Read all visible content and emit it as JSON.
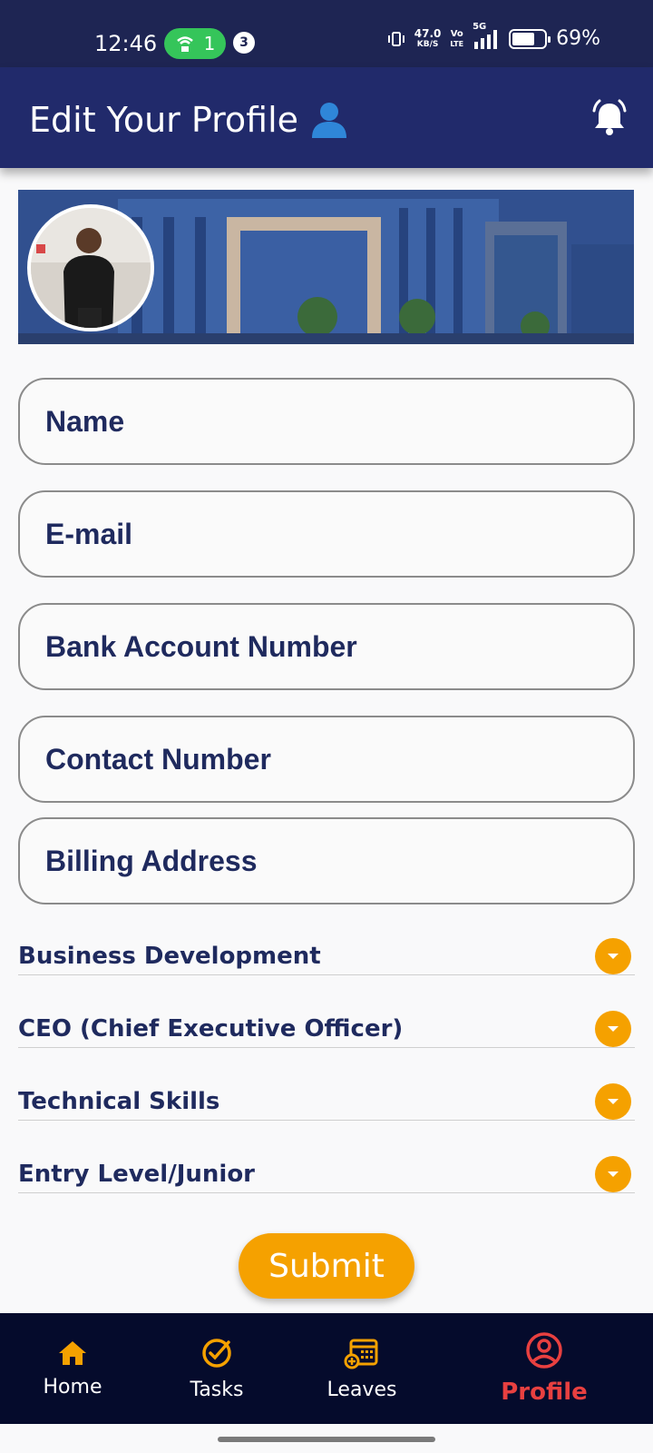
{
  "status_bar": {
    "time": "12:46",
    "hotspot_count": "1",
    "notification_count": "3",
    "net_speed_value": "47.0",
    "net_speed_unit": "KB/S",
    "volte_top": "Vo",
    "volte_bottom": "LTE",
    "network": "5G",
    "battery": "69%"
  },
  "header": {
    "title": "Edit Your Profile",
    "title_icon": "user-icon",
    "bell_icon": "bell-icon"
  },
  "form": {
    "fields": [
      {
        "placeholder": "Name",
        "value": ""
      },
      {
        "placeholder": "E-mail",
        "value": ""
      },
      {
        "placeholder": "Bank Account Number",
        "value": ""
      },
      {
        "placeholder": "Contact Number",
        "value": ""
      },
      {
        "placeholder": "Billing Address",
        "value": ""
      }
    ],
    "dropdowns": [
      {
        "selected": "Business Development"
      },
      {
        "selected": "CEO (Chief Executive Officer)"
      },
      {
        "selected": "Technical Skills"
      },
      {
        "selected": "Entry Level/Junior"
      }
    ],
    "submit_label": "Submit"
  },
  "bottom_nav": {
    "items": [
      {
        "label": "Home",
        "icon": "home-icon"
      },
      {
        "label": "Tasks",
        "icon": "check-circle-icon"
      },
      {
        "label": "Leaves",
        "icon": "calendar-add-icon"
      },
      {
        "label": "Profile",
        "icon": "profile-icon"
      }
    ],
    "active": "Profile"
  },
  "colors": {
    "status_bar": "#1e2553",
    "app_bar": "#212a6b",
    "accent": "#f5a100",
    "text_primary": "#1f2a5e",
    "nav_bg": "#050b2c",
    "nav_active": "#e84040"
  }
}
